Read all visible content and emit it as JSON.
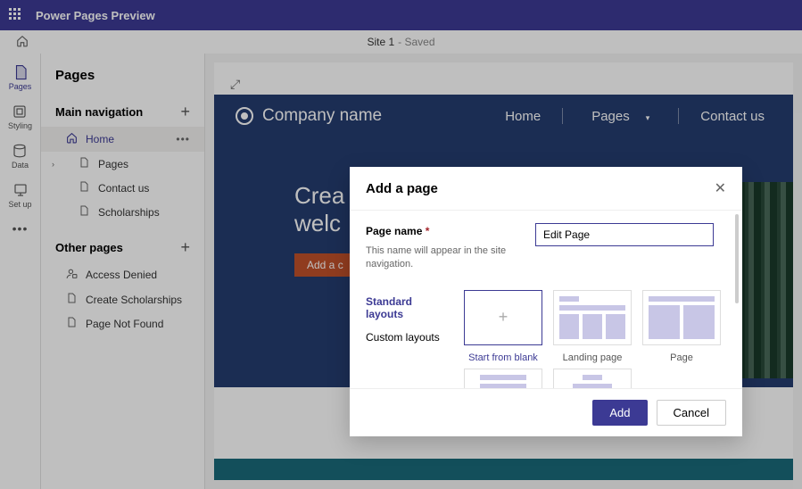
{
  "topbar": {
    "title": "Power Pages Preview"
  },
  "subbar": {
    "site": "Site 1",
    "status": "- Saved"
  },
  "rail": {
    "pages": "Pages",
    "styling": "Styling",
    "data": "Data",
    "setup": "Set up"
  },
  "sidebar": {
    "title": "Pages",
    "group1": "Main navigation",
    "group2": "Other pages",
    "home": "Home",
    "pages": "Pages",
    "contact": "Contact us",
    "scholarships": "Scholarships",
    "access": "Access Denied",
    "createsch": "Create Scholarships",
    "notfound": "Page Not Found"
  },
  "site": {
    "company": "Company name",
    "nav_home": "Home",
    "nav_pages": "Pages",
    "nav_contact": "Contact us",
    "hero1": "Crea",
    "hero2": "welc",
    "cta": "Add a c"
  },
  "modal": {
    "title": "Add a page",
    "label": "Page name",
    "hint": "This name will appear in the site navigation.",
    "value": "Edit Page",
    "tab1": "Standard layouts",
    "tab2": "Custom layouts",
    "opt_blank": "Start from blank",
    "opt_landing": "Landing page",
    "opt_page": "Page",
    "btn_add": "Add",
    "btn_cancel": "Cancel"
  }
}
